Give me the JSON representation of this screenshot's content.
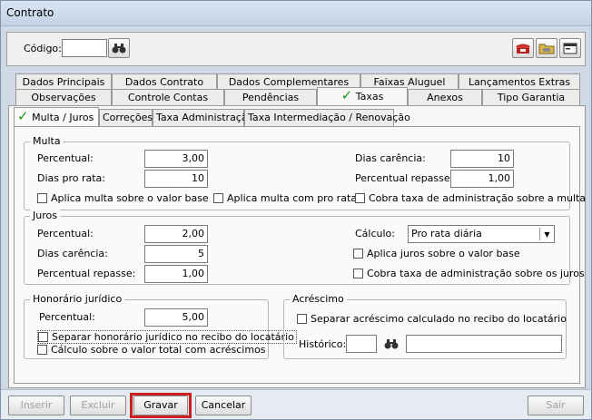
{
  "window": {
    "title": "Contrato"
  },
  "header": {
    "codigo_label": "Código:",
    "codigo_value": ""
  },
  "tabs_row1": [
    "Dados Principais",
    "Dados Contrato",
    "Dados Complementares",
    "Faixas Aluguel",
    "Lançamentos Extras"
  ],
  "tabs_row2": [
    "Observações",
    "Controle Contas",
    "Pendências",
    "Taxas",
    "Anexos",
    "Tipo Garantia"
  ],
  "subtabs": [
    "Multa / Juros",
    "Correções",
    "Taxa Administração",
    "Taxa Intermediação / Renovação"
  ],
  "multa": {
    "title": "Multa",
    "percentual_label": "Percentual:",
    "percentual_value": "3,00",
    "dias_pro_rata_label": "Dias pro rata:",
    "dias_pro_rata_value": "10",
    "dias_carencia_label": "Dias carência:",
    "dias_carencia_value": "10",
    "percentual_repasse_label": "Percentual repasse:",
    "percentual_repasse_value": "1,00",
    "chk_valor_base": "Aplica multa sobre o valor base",
    "chk_pro_rata": "Aplica multa com pro rata",
    "chk_cobra_taxa": "Cobra taxa de administração sobre a multa"
  },
  "juros": {
    "title": "Juros",
    "percentual_label": "Percentual:",
    "percentual_value": "2,00",
    "dias_carencia_label": "Dias carência:",
    "dias_carencia_value": "5",
    "percentual_repasse_label": "Percentual repasse:",
    "percentual_repasse_value": "1,00",
    "calculo_label": "Cálculo:",
    "calculo_value": "Pro rata diária",
    "chk_valor_base": "Aplica juros sobre o valor base",
    "chk_cobra_taxa": "Cobra taxa de administração sobre os juros"
  },
  "honorario": {
    "title": "Honorário jurídico",
    "percentual_label": "Percentual:",
    "percentual_value": "5,00",
    "chk_separar": "Separar honorário jurídico no recibo do locatário",
    "chk_calculo": "Cálculo sobre o valor total com acréscimos"
  },
  "acrescimo": {
    "title": "Acréscimo",
    "chk_separar": "Separar acréscimo calculado no recibo do locatário",
    "historico_label": "Histórico:"
  },
  "buttons": {
    "inserir": "Inserir",
    "excluir": "Excluir",
    "gravar": "Gravar",
    "cancelar": "Cancelar",
    "sair": "Sair"
  },
  "colors": {
    "highlight": "#cc1f1f",
    "check": "#1a9a1a"
  }
}
